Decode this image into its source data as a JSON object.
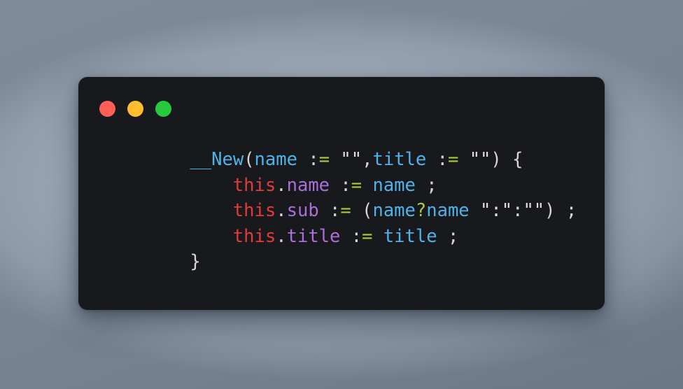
{
  "window": {
    "controls": [
      {
        "name": "close",
        "color": "#ff5f56"
      },
      {
        "name": "minimize",
        "color": "#ffbd2e"
      },
      {
        "name": "maximize",
        "color": "#27c93f"
      }
    ]
  },
  "background": {
    "top_color": "#a9b5c3",
    "bottom_color": "#8d9aaa"
  },
  "editor": {
    "background": "#18191c",
    "language": "AutoHotkey",
    "palette": {
      "keyword_this": "#e23b3b",
      "property": "#a970d8",
      "identifier": "#4fb3e8",
      "function": "#4fb3e8",
      "operator": "#a6ce39",
      "punctuation": "#d6d6d6",
      "string": "#e0e0e0"
    },
    "lines": [
      {
        "indent": "    ",
        "tokens": [
          {
            "t": "__New",
            "c": "func"
          },
          {
            "t": "(",
            "c": "punct"
          },
          {
            "t": "name",
            "c": "ident"
          },
          {
            "t": " ",
            "c": "space"
          },
          {
            "t": ":",
            "c": "colon"
          },
          {
            "t": "=",
            "c": "op"
          },
          {
            "t": " ",
            "c": "space"
          },
          {
            "t": "\"\"",
            "c": "string"
          },
          {
            "t": ",",
            "c": "punct"
          },
          {
            "t": "title",
            "c": "ident"
          },
          {
            "t": " ",
            "c": "space"
          },
          {
            "t": ":",
            "c": "colon"
          },
          {
            "t": "=",
            "c": "op"
          },
          {
            "t": " ",
            "c": "space"
          },
          {
            "t": "\"\"",
            "c": "string"
          },
          {
            "t": ")",
            "c": "punct"
          },
          {
            "t": " ",
            "c": "space"
          },
          {
            "t": "{",
            "c": "punct"
          }
        ]
      },
      {
        "indent": "        ",
        "tokens": [
          {
            "t": "this",
            "c": "this"
          },
          {
            "t": ".",
            "c": "punct"
          },
          {
            "t": "name",
            "c": "prop"
          },
          {
            "t": " ",
            "c": "space"
          },
          {
            "t": ":",
            "c": "colon"
          },
          {
            "t": "=",
            "c": "op"
          },
          {
            "t": " ",
            "c": "space"
          },
          {
            "t": "name",
            "c": "ident"
          },
          {
            "t": " ",
            "c": "space"
          },
          {
            "t": ";",
            "c": "punct"
          }
        ]
      },
      {
        "indent": "        ",
        "tokens": [
          {
            "t": "this",
            "c": "this"
          },
          {
            "t": ".",
            "c": "punct"
          },
          {
            "t": "sub",
            "c": "prop"
          },
          {
            "t": " ",
            "c": "space"
          },
          {
            "t": ":",
            "c": "colon"
          },
          {
            "t": "=",
            "c": "op"
          },
          {
            "t": " ",
            "c": "space"
          },
          {
            "t": "(",
            "c": "punct"
          },
          {
            "t": "name",
            "c": "ident"
          },
          {
            "t": "?",
            "c": "op"
          },
          {
            "t": "name",
            "c": "ident"
          },
          {
            "t": " ",
            "c": "space"
          },
          {
            "t": "\":\"",
            "c": "string"
          },
          {
            "t": ":",
            "c": "colon"
          },
          {
            "t": "\"\"",
            "c": "string"
          },
          {
            "t": ")",
            "c": "punct"
          },
          {
            "t": " ",
            "c": "space"
          },
          {
            "t": ";",
            "c": "punct"
          }
        ]
      },
      {
        "indent": "        ",
        "tokens": [
          {
            "t": "this",
            "c": "this"
          },
          {
            "t": ".",
            "c": "punct"
          },
          {
            "t": "title",
            "c": "prop"
          },
          {
            "t": " ",
            "c": "space"
          },
          {
            "t": ":",
            "c": "colon"
          },
          {
            "t": "=",
            "c": "op"
          },
          {
            "t": " ",
            "c": "space"
          },
          {
            "t": "title",
            "c": "ident"
          },
          {
            "t": " ",
            "c": "space"
          },
          {
            "t": ";",
            "c": "punct"
          }
        ]
      },
      {
        "indent": "    ",
        "tokens": [
          {
            "t": "}",
            "c": "punct"
          }
        ]
      }
    ]
  }
}
